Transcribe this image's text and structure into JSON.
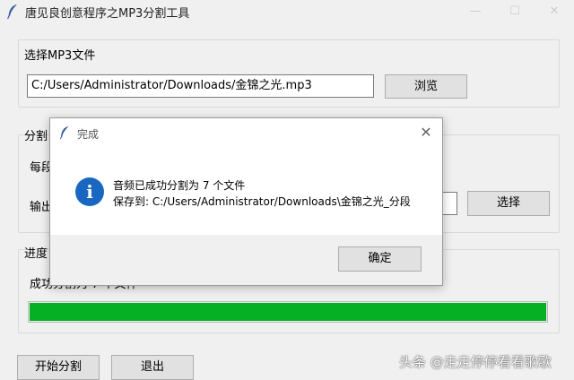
{
  "window": {
    "title": "唐见良创意程序之MP3分割工具",
    "minimize_icon": "minimize-icon",
    "maximize_icon": "maximize-icon",
    "close_icon": "close-icon"
  },
  "select_section": {
    "label": "选择MP3文件",
    "file_path": "C:/Users/Administrator/Downloads/金锦之光.mp3",
    "browse_label": "浏览"
  },
  "split_section": {
    "label": "分割",
    "row1_label": "每段",
    "row2_label": "输出",
    "choose_label": "选择"
  },
  "progress_section": {
    "label": "进度",
    "status": "成功分割为 7 个文件",
    "progress_fraction": 1.0,
    "bar_color": "#06b025"
  },
  "actions": {
    "start_label": "开始分割",
    "exit_label": "退出"
  },
  "dialog": {
    "title": "完成",
    "icon": "info-icon",
    "message_line1": "音频已成功分割为 7 个文件",
    "message_line2": "保存到: C:/Users/Administrator/Downloads\\金锦之光_分段",
    "ok_label": "确定"
  },
  "watermark": "头条 @走走停停看看歌歌"
}
